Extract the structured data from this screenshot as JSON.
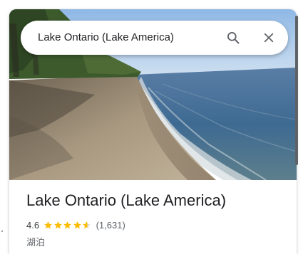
{
  "search": {
    "query": "Lake Ontario (Lake America)"
  },
  "place": {
    "name": "Lake Ontario (Lake America)",
    "rating": "4.6",
    "rating_stars": 4.6,
    "review_count": "(1,631)",
    "category": "湖泊"
  },
  "colors": {
    "star": "#fbbc04",
    "star_empty": "#dadce0",
    "title_text": "#202124",
    "secondary_text": "#5f6368",
    "icon": "#5f6368"
  },
  "icons": {
    "search": "search-icon",
    "close": "close-icon",
    "star": "star-icon"
  }
}
